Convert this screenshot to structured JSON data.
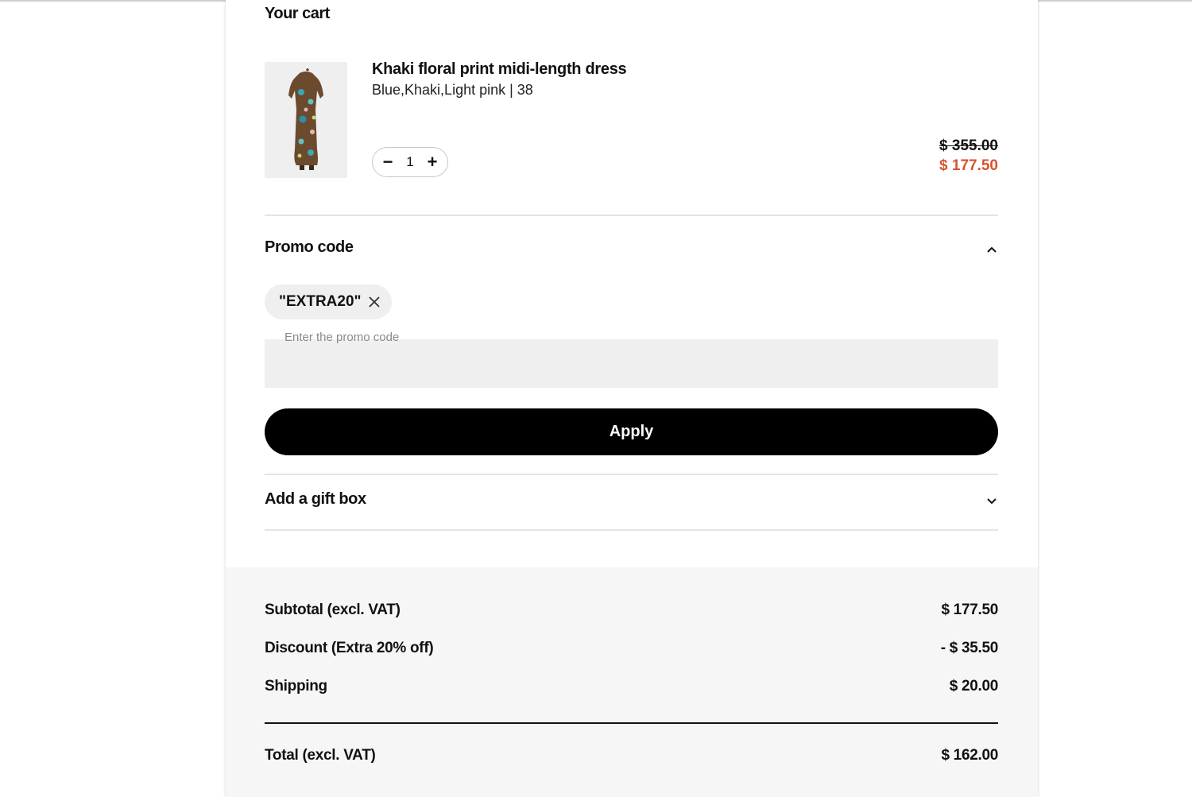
{
  "cart": {
    "title": "Your cart",
    "item": {
      "name": "Khaki floral print midi-length dress",
      "variant": "Blue,Khaki,Light pink | 38",
      "quantity": "1",
      "minus": "−",
      "plus": "+",
      "price_original": "$ 355.00",
      "price_sale": "$ 177.50",
      "thumbnail_icon": "dress-image"
    }
  },
  "promo": {
    "title": "Promo code",
    "applied_code": "\"EXTRA20\"",
    "input_label": "Enter the promo code",
    "input_value": "",
    "apply_label": "Apply",
    "expanded": true
  },
  "gift": {
    "title": "Add a gift box",
    "expanded": false
  },
  "summary": {
    "subtotal_label": "Subtotal (excl. VAT)",
    "subtotal_value": "$ 177.50",
    "discount_label": "Discount (Extra 20% off)",
    "discount_value": "- $ 35.50",
    "shipping_label": "Shipping",
    "shipping_value": "$ 20.00",
    "total_label": "Total (excl. VAT)",
    "total_value": "$ 162.00"
  },
  "colors": {
    "sale": "#d9532c",
    "button": "#000000",
    "summary_bg": "#f6f6f6"
  }
}
